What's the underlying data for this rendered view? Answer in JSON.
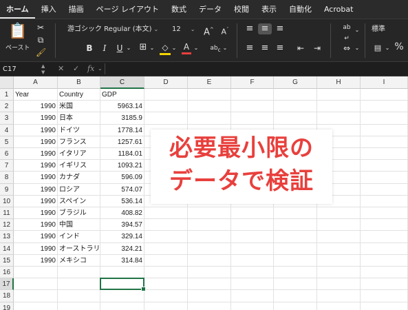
{
  "ribbon_tabs": [
    "ホーム",
    "挿入",
    "描画",
    "ページ レイアウト",
    "数式",
    "データ",
    "校閲",
    "表示",
    "自動化",
    "Acrobat"
  ],
  "clipboard": {
    "paste_label": "ペースト"
  },
  "font": {
    "name": "游ゴシック Regular (本文)",
    "size": "12",
    "bold": "B",
    "italic": "I",
    "underline": "U"
  },
  "number_format": {
    "value": "標準",
    "percent": "%"
  },
  "formula_bar": {
    "name_box": "C17",
    "fx_label": "fx",
    "value": ""
  },
  "columns": [
    "A",
    "B",
    "C",
    "D",
    "E",
    "F",
    "G",
    "H",
    "I"
  ],
  "selected_column": "C",
  "selected_row": "17",
  "rows": [
    {
      "n": "1",
      "a": "Year",
      "b": "Country",
      "c": "GDP"
    },
    {
      "n": "2",
      "a": "1990",
      "b": "米国",
      "c": "5963.14"
    },
    {
      "n": "3",
      "a": "1990",
      "b": "日本",
      "c": "3185.9"
    },
    {
      "n": "4",
      "a": "1990",
      "b": "ドイツ",
      "c": "1778.14"
    },
    {
      "n": "5",
      "a": "1990",
      "b": "フランス",
      "c": "1257.61"
    },
    {
      "n": "6",
      "a": "1990",
      "b": "イタリア",
      "c": "1184.01"
    },
    {
      "n": "7",
      "a": "1990",
      "b": "イギリス",
      "c": "1093.21"
    },
    {
      "n": "8",
      "a": "1990",
      "b": "カナダ",
      "c": "596.09"
    },
    {
      "n": "9",
      "a": "1990",
      "b": "ロシア",
      "c": "574.07"
    },
    {
      "n": "10",
      "a": "1990",
      "b": "スペイン",
      "c": "536.14"
    },
    {
      "n": "11",
      "a": "1990",
      "b": "ブラジル",
      "c": "408.82"
    },
    {
      "n": "12",
      "a": "1990",
      "b": "中国",
      "c": "394.57"
    },
    {
      "n": "13",
      "a": "1990",
      "b": "インド",
      "c": "329.14"
    },
    {
      "n": "14",
      "a": "1990",
      "b": "オーストラリ",
      "c": "324.21"
    },
    {
      "n": "15",
      "a": "1990",
      "b": "メキシコ",
      "c": "314.84"
    },
    {
      "n": "16",
      "a": "",
      "b": "",
      "c": ""
    },
    {
      "n": "17",
      "a": "",
      "b": "",
      "c": ""
    },
    {
      "n": "18",
      "a": "",
      "b": "",
      "c": ""
    },
    {
      "n": "19",
      "a": "",
      "b": "",
      "c": ""
    }
  ],
  "callout": {
    "line1": "必要最小限の",
    "line2": "データで検証"
  },
  "colors": {
    "accent": "#217346",
    "callout_text": "#e8403d",
    "ribbon_bg": "#262626"
  }
}
